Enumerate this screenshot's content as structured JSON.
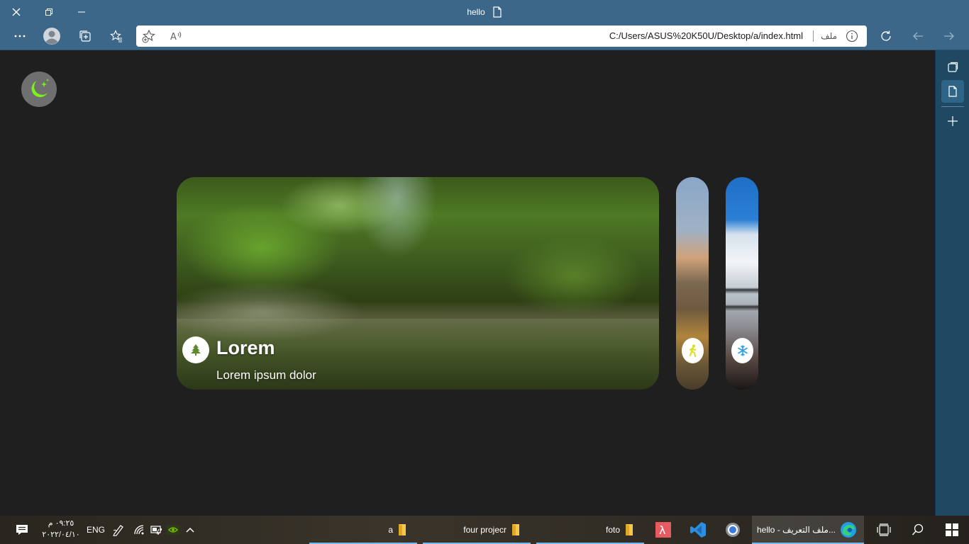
{
  "browser": {
    "tab_title": "hello",
    "address": {
      "url": "C:/Users/ASUS%20K50U/Desktop/a/index.html",
      "file_label": "ملف"
    },
    "accent_color": "#3c6788"
  },
  "page": {
    "background": "#1f1f1f",
    "theme_toggle_icon": "moon-stars-icon",
    "cards": [
      {
        "title": "Lorem",
        "subtitle": "Lorem ipsum dolor",
        "icon": "tree-icon",
        "icon_color": "#5c8a2b",
        "expanded": true
      },
      {
        "icon": "hiker-icon",
        "icon_color": "#d8e01a",
        "expanded": false
      },
      {
        "icon": "snowflake-icon",
        "icon_color": "#2e9fe0",
        "expanded": false
      }
    ]
  },
  "taskbar": {
    "language": "ENG",
    "clock_time": "٠٩:٢٥ م",
    "clock_date": "٢٠٢٢/٠٤/١٠",
    "items": [
      {
        "label": "a",
        "icon": "folder-icon"
      },
      {
        "label": "four projecr",
        "icon": "folder-icon"
      },
      {
        "label": "foto",
        "icon": "folder-icon"
      },
      {
        "label": "",
        "icon": "lambda-app-icon"
      },
      {
        "label": "",
        "icon": "vscode-icon"
      },
      {
        "label": "",
        "icon": "chrome-icon"
      },
      {
        "label": "hello - ملف التعريف...",
        "icon": "edge-icon"
      }
    ]
  }
}
